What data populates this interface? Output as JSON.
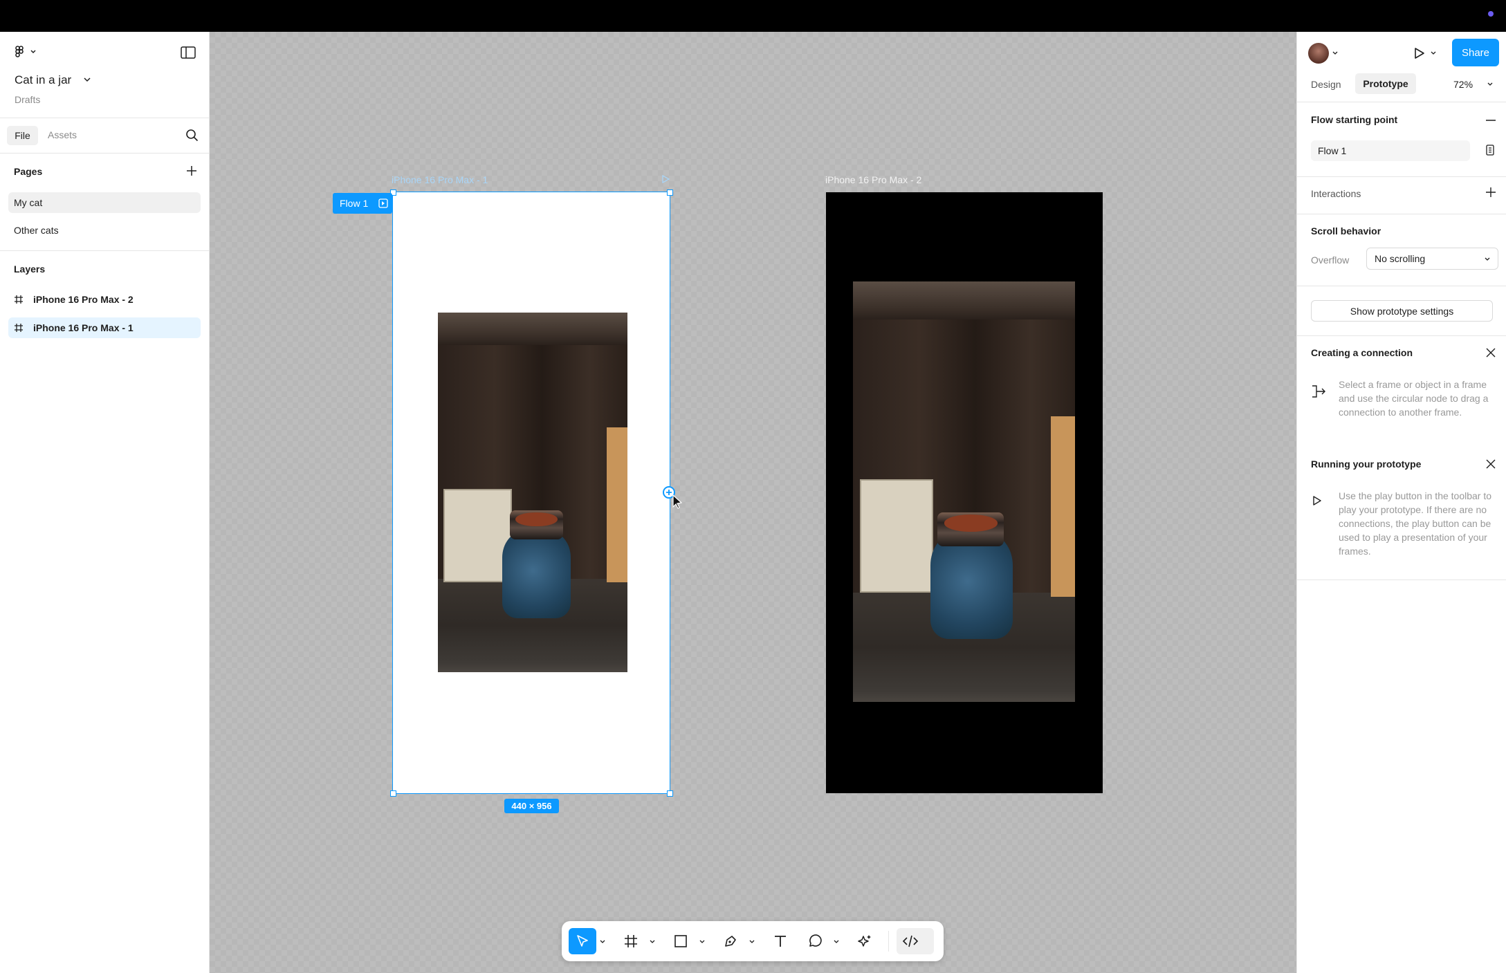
{
  "file": {
    "title": "Cat in a jar",
    "location": "Drafts"
  },
  "left_panel": {
    "tabs": [
      "File",
      "Assets"
    ],
    "pages_heading": "Pages",
    "pages": [
      "My cat",
      "Other cats"
    ],
    "layers_heading": "Layers",
    "layers": [
      "iPhone 16 Pro Max - 2",
      "iPhone 16 Pro Max - 1"
    ]
  },
  "canvas": {
    "frame1_label": "iPhone 16 Pro Max - 1",
    "frame2_label": "iPhone 16 Pro Max - 2",
    "flow_badge": "Flow 1",
    "dimensions": "440 × 956"
  },
  "right_panel": {
    "share_label": "Share",
    "tabs": [
      "Design",
      "Prototype"
    ],
    "zoom": "72%",
    "flow_heading": "Flow starting point",
    "flow_name": "Flow 1",
    "interactions_heading": "Interactions",
    "scroll_heading": "Scroll behavior",
    "overflow_label": "Overflow",
    "overflow_value": "No scrolling",
    "settings_button": "Show prototype settings",
    "connection_heading": "Creating a connection",
    "connection_text": "Select a frame or object in a frame and use the circular node to drag a connection to another frame.",
    "running_heading": "Running your prototype",
    "running_text": "Use the play button in the toolbar to play your prototype. If there are no connections, the play button can be used to play a presentation of your frames."
  },
  "help_label": "?",
  "colors": {
    "accent": "#0d99ff",
    "canvas": "#b7b7b7",
    "selected_layer": "#e5f4ff"
  },
  "icons": [
    "figma-logo-icon",
    "sidebar-toggle-icon",
    "search-icon",
    "add-page-icon",
    "frame-icon",
    "avatar",
    "play-icon",
    "minus-icon",
    "flow-settings-icon",
    "add-interaction-icon",
    "chevron-down-icon",
    "close-icon",
    "connection-icon",
    "move-tool-icon",
    "frame-tool-icon",
    "rectangle-tool-icon",
    "pen-tool-icon",
    "text-tool-icon",
    "comment-tool-icon",
    "actions-tool-icon",
    "dev-mode-icon",
    "help-icon",
    "connection-node-icon",
    "cursor-icon"
  ]
}
